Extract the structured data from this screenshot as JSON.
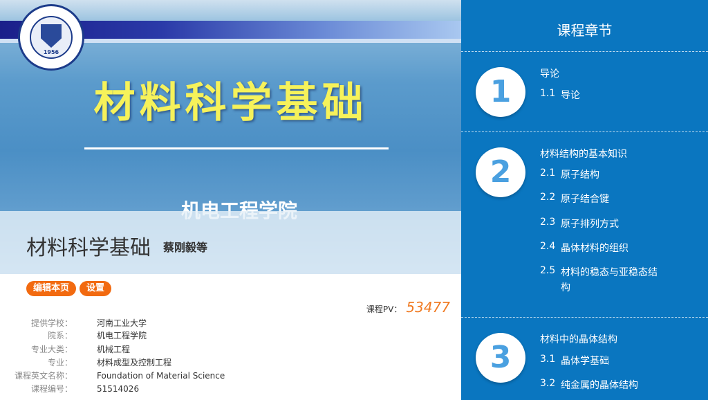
{
  "banner": {
    "title": "材料科学基础",
    "school": "机电工程学院",
    "logo_year": "1956"
  },
  "course": {
    "name": "材料科学基础",
    "author": "蔡刚毅等"
  },
  "actions": {
    "edit_label": "编辑本页",
    "settings_label": "设置"
  },
  "stats": {
    "pv_label": "课程PV：",
    "pv_value": "53477"
  },
  "info": [
    {
      "key": "提供学校：",
      "value": "河南工业大学"
    },
    {
      "key": "院系：",
      "value": "机电工程学院"
    },
    {
      "key": "专业大类：",
      "value": "机械工程"
    },
    {
      "key": "专业：",
      "value": "材料成型及控制工程"
    },
    {
      "key": "课程英文名称：",
      "value": "Foundation of Material Science"
    },
    {
      "key": "课程编号：",
      "value": "51514026"
    }
  ],
  "chapters_panel": {
    "title": "课程章节",
    "chapters": [
      {
        "number": "1",
        "title": "导论",
        "items": [
          {
            "num": "1.1",
            "text": "导论"
          }
        ]
      },
      {
        "number": "2",
        "title": "材料结构的基本知识",
        "items": [
          {
            "num": "2.1",
            "text": "原子结构"
          },
          {
            "num": "2.2",
            "text": "原子结合键"
          },
          {
            "num": "2.3",
            "text": "原子排列方式"
          },
          {
            "num": "2.4",
            "text": "晶体材料的组织"
          },
          {
            "num": "2.5",
            "text": "材料的稳态与亚稳态结构"
          }
        ]
      },
      {
        "number": "3",
        "title": "材料中的晶体结构",
        "items": [
          {
            "num": "3.1",
            "text": "晶体学基础"
          },
          {
            "num": "3.2",
            "text": "纯金属的晶体结构"
          }
        ]
      }
    ]
  },
  "colors": {
    "accent_orange": "#f26a10",
    "panel_blue": "#0a76c0",
    "title_yellow": "#f6f25a"
  }
}
